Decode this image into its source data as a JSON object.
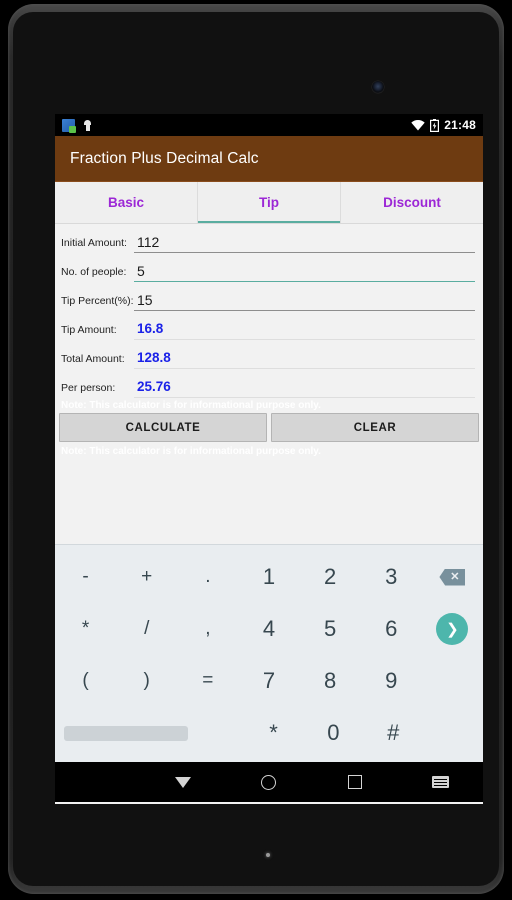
{
  "status_bar": {
    "time": "21:48",
    "left_icons": [
      "app-notification-icon",
      "adb-icon"
    ],
    "right_icons": [
      "wifi-icon",
      "battery-charging-icon"
    ]
  },
  "app": {
    "title": "Fraction Plus Decimal Calc",
    "title_bar_color": "#6e3b11"
  },
  "tabs": {
    "active_color": "#5aada0",
    "label_color": "#9c27d6",
    "items": [
      {
        "label": "Basic",
        "active": false
      },
      {
        "label": "Tip",
        "active": true
      },
      {
        "label": "Discount",
        "active": false
      }
    ]
  },
  "form": {
    "fields": [
      {
        "label": "Initial Amount:",
        "value": "112",
        "focused": false
      },
      {
        "label": "No. of people:",
        "value": "5",
        "focused": true
      },
      {
        "label": "Tip Percent(%):",
        "value": "15",
        "focused": false
      }
    ],
    "results": [
      {
        "label": "Tip Amount:",
        "value": "16.8"
      },
      {
        "label": "Total Amount:",
        "value": "128.8"
      },
      {
        "label": "Per person:",
        "value": "25.76"
      }
    ],
    "result_color": "#1b22e8",
    "note_top": "Note: This calculator is for informational purpose only.",
    "note_bottom": "Note: This calculator is for informational purpose only."
  },
  "buttons": {
    "calculate": "CALCULATE",
    "clear": "CLEAR"
  },
  "keyboard": {
    "accent_color": "#4db6ac",
    "rows": [
      [
        "-",
        "+",
        ".",
        "1",
        "2",
        "3"
      ],
      [
        "*",
        "/",
        ",",
        "4",
        "5",
        "6"
      ],
      [
        "(",
        ")",
        "=",
        "7",
        "8",
        "9"
      ],
      [
        "*",
        "0",
        "#"
      ]
    ],
    "backspace_icon": "backspace-icon",
    "enter_icon": "enter-arrow-icon",
    "space_icon": "space-bar"
  },
  "nav_bar": {
    "back": "back-triangle-icon",
    "home": "home-circle-icon",
    "recents": "recents-square-icon",
    "keyboard_switch": "keyboard-switch-icon"
  }
}
